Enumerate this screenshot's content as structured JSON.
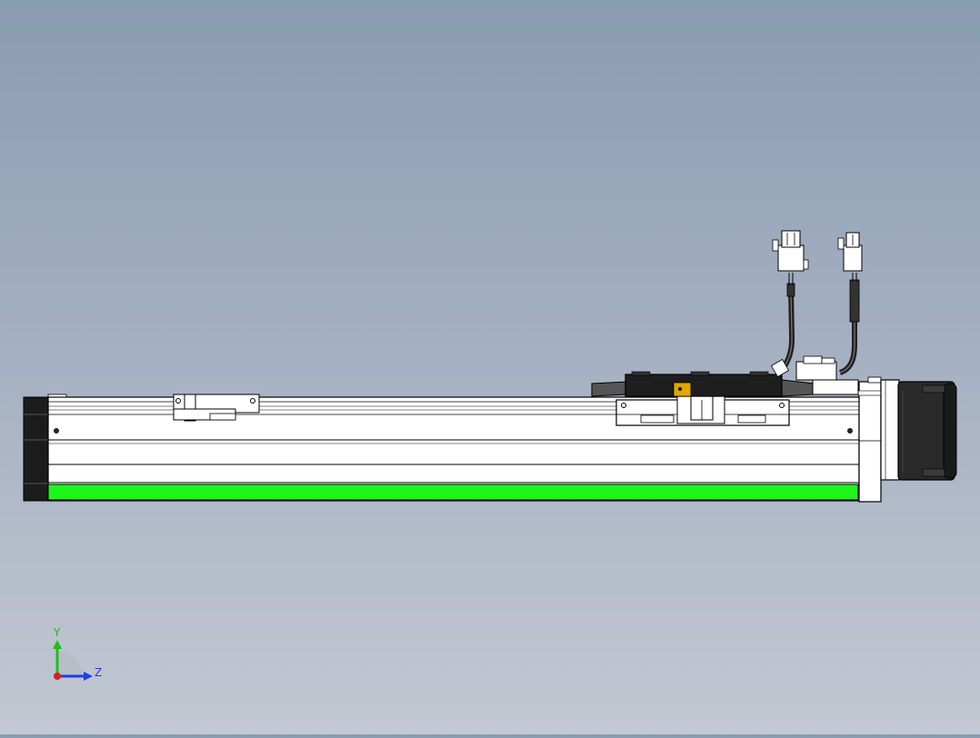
{
  "triad": {
    "y_label": "Y",
    "z_label": "Z",
    "y_color": "#19c219",
    "z_color": "#1f3fe0",
    "x_color": "#d92020"
  },
  "colors": {
    "background_top": "#8a9cb1",
    "background_bottom": "#c3c8d2",
    "profile_stripe": "#1df51d",
    "outline": "#000000",
    "part_fill": "#ffffff",
    "end_cap": "#1c1c1c",
    "motor_body": "#2a2a2a",
    "slider_plate": "#1e1e1e",
    "bracket_accent": "#e0a800"
  }
}
